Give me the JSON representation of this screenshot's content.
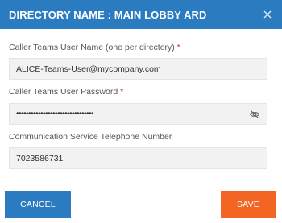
{
  "dialog": {
    "title": "DIRECTORY NAME : MAIN LOBBY ARD"
  },
  "fields": {
    "caller_user": {
      "label": "Caller Teams User Name (one per directory)",
      "required_mark": "*",
      "value": "ALICE-Teams-User@mycompany.com"
    },
    "caller_password": {
      "label": "Caller Teams User Password",
      "required_mark": "*",
      "value": "••••••••••••••••••••••••••••••••"
    },
    "telephone": {
      "label": "Communication Service Telephone Number",
      "value": "7023586731"
    }
  },
  "buttons": {
    "cancel": "CANCEL",
    "save": "SAVE"
  },
  "colors": {
    "header": "#2b7bc0",
    "cancel_button": "#2b7bc0",
    "save_button": "#f26522",
    "required": "#d0282f"
  },
  "icons": {
    "close": "close-icon",
    "toggle_password": "eye-slash-icon"
  }
}
